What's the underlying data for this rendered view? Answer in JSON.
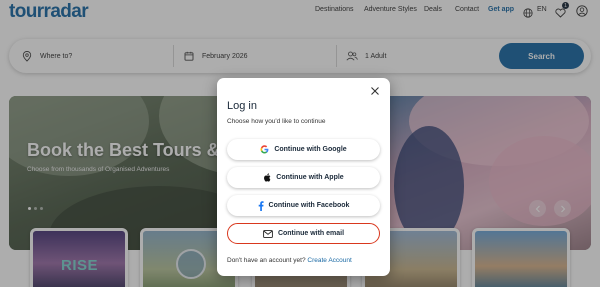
{
  "header": {
    "logo": "tourradar",
    "logo_tm": "™",
    "nav": [
      "Destinations",
      "Adventure Styles",
      "Deals",
      "Contact"
    ],
    "get_app": "Get app",
    "language": "EN",
    "wishlist_count": "1"
  },
  "search": {
    "destination_placeholder": "Where to?",
    "date_value": "February 2026",
    "travellers_value": "1 Adult",
    "button": "Search"
  },
  "hero": {
    "title": "Book the Best Tours &",
    "subtitle": "Choose from thousands of Organised Adventures"
  },
  "cards": [
    {
      "label": "RISE"
    }
  ],
  "modal": {
    "title": "Log in",
    "subtitle": "Choose how you'd like to continue",
    "google": "Continue with Google",
    "apple": "Continue with Apple",
    "facebook": "Continue with Facebook",
    "email": "Continue with email",
    "no_account": "Don't have an account yet?",
    "create_account": "Create Account"
  },
  "colors": {
    "brand": "#1b6aa5",
    "highlight": "#d9381e"
  }
}
